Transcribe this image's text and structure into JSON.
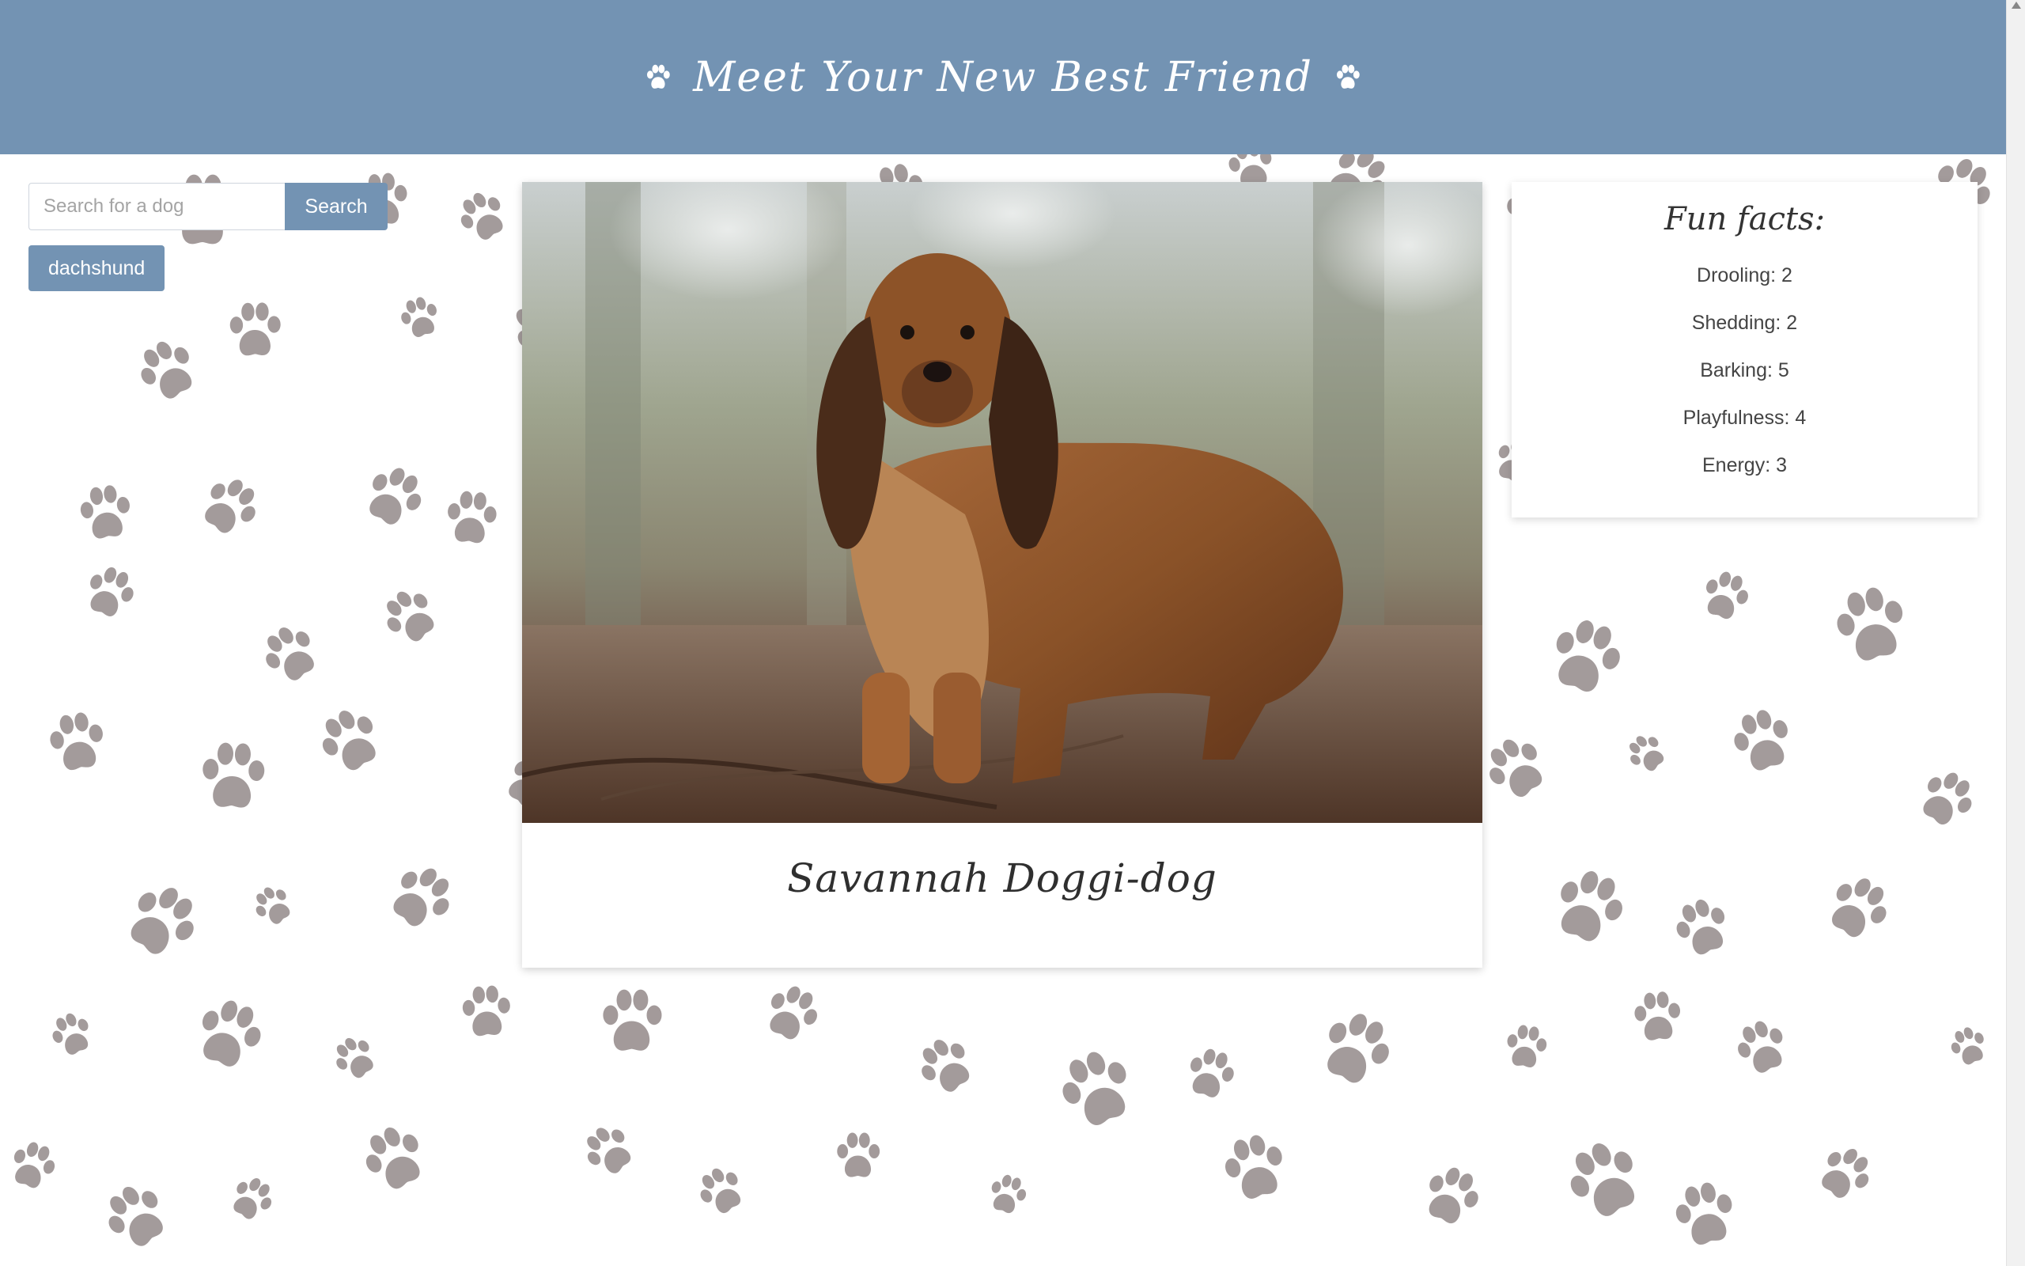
{
  "header": {
    "title": "Meet Your New Best Friend",
    "left_icon": "paw-icon",
    "right_icon": "paw-icon",
    "background_color": "#7393b3"
  },
  "search": {
    "placeholder": "Search for a dog",
    "value": "",
    "button_label": "Search"
  },
  "breeds": [
    {
      "label": "dachshund"
    }
  ],
  "dog": {
    "name": "Savannah Doggi-dog",
    "photo_description": "long-haired dachshund standing on forest floor"
  },
  "fun_facts": {
    "title": "Fun facts:",
    "items": [
      {
        "label": "Drooling: 2"
      },
      {
        "label": "Shedding: 2"
      },
      {
        "label": "Barking: 5"
      },
      {
        "label": "Playfulness: 4"
      },
      {
        "label": "Energy: 3"
      }
    ]
  },
  "colors": {
    "accent": "#7393b3",
    "paw": "#8f8585",
    "card": "#ffffff"
  }
}
